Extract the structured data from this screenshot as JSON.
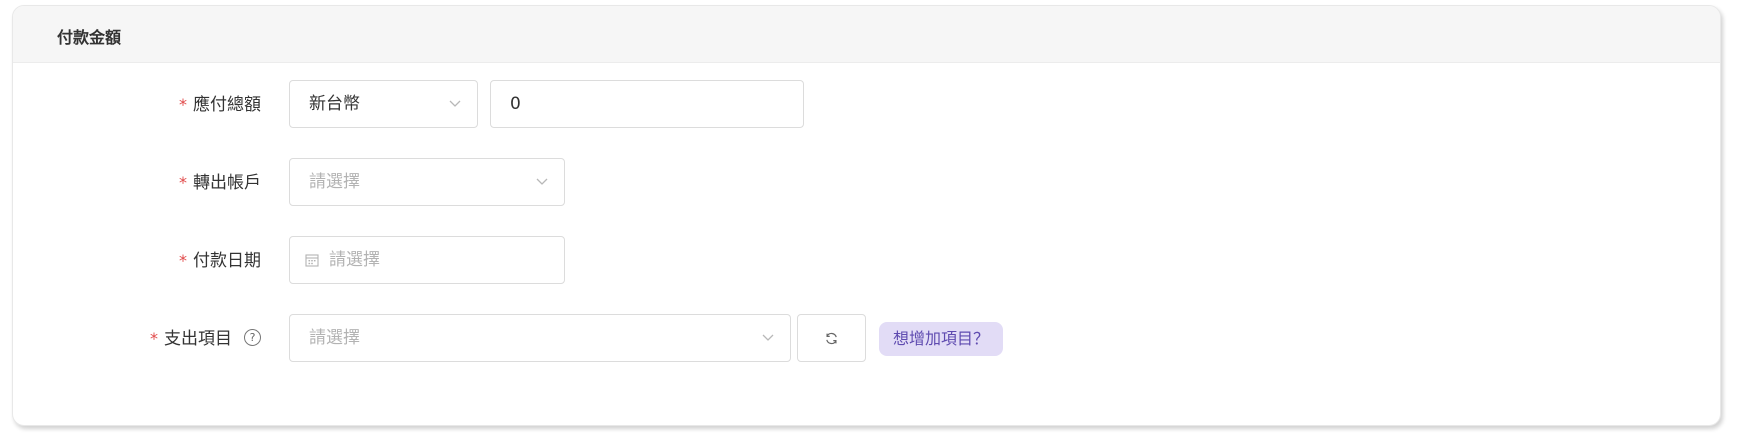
{
  "section": {
    "title": "付款金額"
  },
  "form": {
    "required_mark": "*",
    "total": {
      "label": "應付總額",
      "currency": "新台幣",
      "amount": "0"
    },
    "account": {
      "label": "轉出帳戶",
      "placeholder": "請選擇"
    },
    "date": {
      "label": "付款日期",
      "placeholder": "請選擇"
    },
    "expense": {
      "label": "支出項目",
      "help": "?",
      "placeholder": "請選擇",
      "add_link": "想增加項目？"
    }
  },
  "icons": {
    "chevron": "chevron-down-icon",
    "calendar": "calendar-icon",
    "refresh": "refresh-icon",
    "help": "question-circle-icon"
  },
  "colors": {
    "required": "#e14a4a",
    "tag_bg": "#e2dcf6",
    "tag_text": "#5f4bb0"
  }
}
